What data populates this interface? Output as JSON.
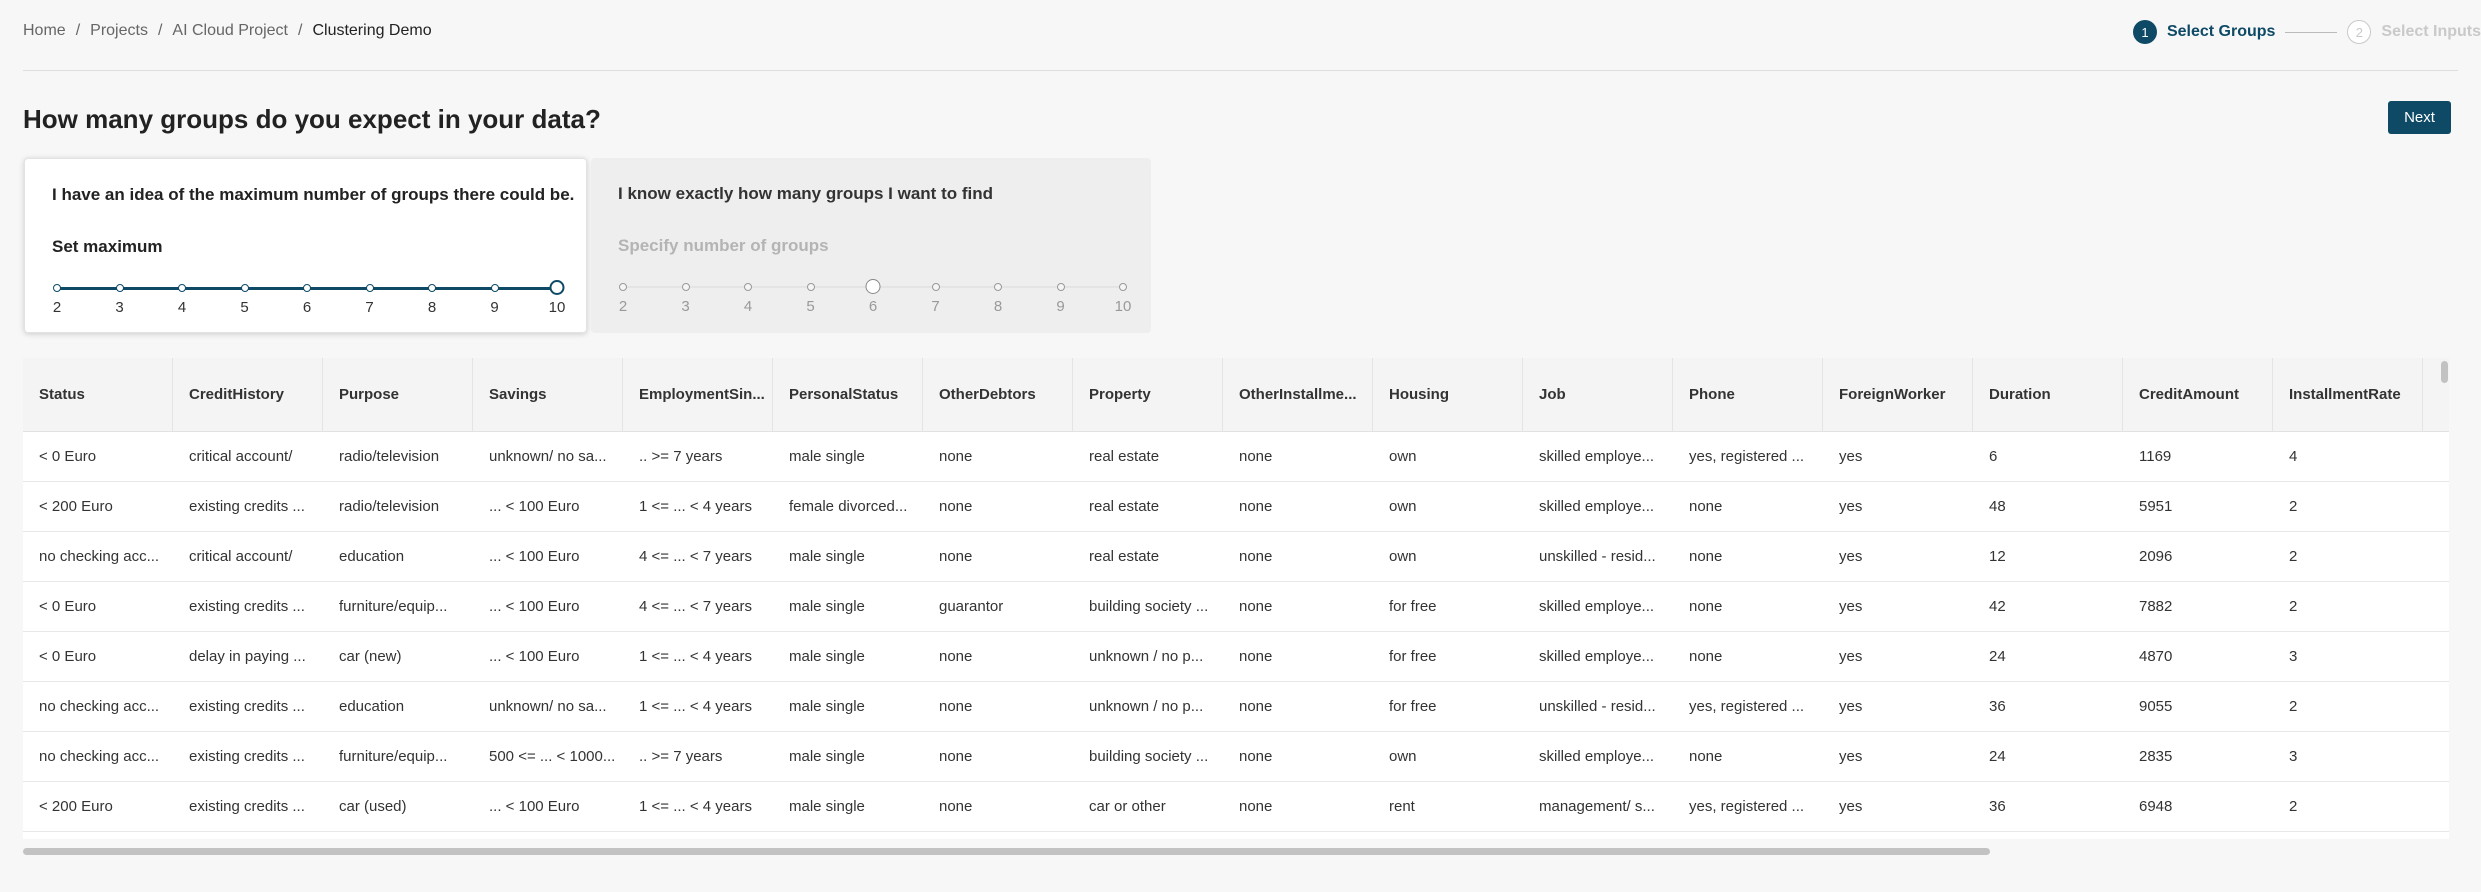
{
  "breadcrumb": [
    "Home",
    "Projects",
    "AI Cloud Project",
    "Clustering Demo"
  ],
  "stepper": [
    {
      "num": "1",
      "label": "Select Groups",
      "active": true
    },
    {
      "num": "2",
      "label": "Select Inputs",
      "active": false
    }
  ],
  "page_title": "How many groups do you expect in your data?",
  "next_label": "Next",
  "options": {
    "max": {
      "title": "I have an idea of the maximum number of groups there could be.",
      "slider_label": "Set maximum",
      "ticks": [
        "2",
        "3",
        "4",
        "5",
        "6",
        "7",
        "8",
        "9",
        "10"
      ],
      "value": 10
    },
    "exact": {
      "title": "I know exactly how many groups I want to find",
      "slider_label": "Specify number of groups",
      "ticks": [
        "2",
        "3",
        "4",
        "5",
        "6",
        "7",
        "8",
        "9",
        "10"
      ],
      "value": 6
    }
  },
  "table": {
    "columns": [
      "Status",
      "CreditHistory",
      "Purpose",
      "Savings",
      "EmploymentSin...",
      "PersonalStatus",
      "OtherDebtors",
      "Property",
      "OtherInstallme...",
      "Housing",
      "Job",
      "Phone",
      "ForeignWorker",
      "Duration",
      "CreditAmount",
      "InstallmentRate"
    ],
    "rows": [
      [
        "< 0 Euro",
        "critical account/",
        "radio/television",
        "unknown/ no sa...",
        ".. >= 7 years",
        "male single",
        "none",
        "real estate",
        "none",
        "own",
        "skilled employe...",
        "yes, registered ...",
        "yes",
        "6",
        "1169",
        "4"
      ],
      [
        "< 200 Euro",
        "existing credits ...",
        "radio/television",
        "... < 100 Euro",
        "1 <= ... < 4 years",
        "female divorced...",
        "none",
        "real estate",
        "none",
        "own",
        "skilled employe...",
        "none",
        "yes",
        "48",
        "5951",
        "2"
      ],
      [
        "no checking acc...",
        "critical account/",
        "education",
        "... < 100 Euro",
        "4 <= ... < 7 years",
        "male single",
        "none",
        "real estate",
        "none",
        "own",
        "unskilled - resid...",
        "none",
        "yes",
        "12",
        "2096",
        "2"
      ],
      [
        "< 0 Euro",
        "existing credits ...",
        "furniture/equip...",
        "... < 100 Euro",
        "4 <= ... < 7 years",
        "male single",
        "guarantor",
        "building society ...",
        "none",
        "for free",
        "skilled employe...",
        "none",
        "yes",
        "42",
        "7882",
        "2"
      ],
      [
        "< 0 Euro",
        "delay in paying ...",
        "car (new)",
        "... < 100 Euro",
        "1 <= ... < 4 years",
        "male single",
        "none",
        "unknown / no p...",
        "none",
        "for free",
        "skilled employe...",
        "none",
        "yes",
        "24",
        "4870",
        "3"
      ],
      [
        "no checking acc...",
        "existing credits ...",
        "education",
        "unknown/ no sa...",
        "1 <= ... < 4 years",
        "male single",
        "none",
        "unknown / no p...",
        "none",
        "for free",
        "unskilled - resid...",
        "yes, registered ...",
        "yes",
        "36",
        "9055",
        "2"
      ],
      [
        "no checking acc...",
        "existing credits ...",
        "furniture/equip...",
        "500 <= ... < 1000...",
        ".. >= 7 years",
        "male single",
        "none",
        "building society ...",
        "none",
        "own",
        "skilled employe...",
        "none",
        "yes",
        "24",
        "2835",
        "3"
      ],
      [
        "< 200 Euro",
        "existing credits ...",
        "car (used)",
        "... < 100 Euro",
        "1 <= ... < 4 years",
        "male single",
        "none",
        "car or other",
        "none",
        "rent",
        "management/ s...",
        "yes, registered ...",
        "yes",
        "36",
        "6948",
        "2"
      ]
    ]
  }
}
